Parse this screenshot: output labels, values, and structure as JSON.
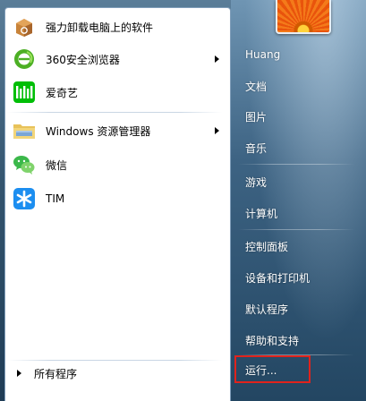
{
  "programs": [
    {
      "label": "强力卸载电脑上的软件",
      "icon": "uninstaller-icon",
      "has_submenu": false
    },
    {
      "label": "360安全浏览器",
      "icon": "360-browser-icon",
      "has_submenu": true
    },
    {
      "label": "爱奇艺",
      "icon": "iqiyi-icon",
      "has_submenu": false
    },
    {
      "label": "Windows 资源管理器",
      "icon": "folder-icon",
      "has_submenu": true
    },
    {
      "label": "微信",
      "icon": "wechat-icon",
      "has_submenu": false
    },
    {
      "label": "TIM",
      "icon": "tim-icon",
      "has_submenu": false
    }
  ],
  "all_programs_label": "所有程序",
  "right_items": [
    {
      "label": "Huang"
    },
    {
      "label": "文档"
    },
    {
      "label": "图片"
    },
    {
      "label": "音乐"
    },
    {
      "label": "游戏"
    },
    {
      "label": "计算机"
    },
    {
      "label": "控制面板"
    },
    {
      "label": "设备和打印机"
    },
    {
      "label": "默认程序"
    },
    {
      "label": "帮助和支持"
    },
    {
      "label": "运行..."
    }
  ],
  "colors": {
    "highlight_border": "#e0231c",
    "iqiyi_green": "#00be06",
    "browser_green": "#4caf24",
    "tim_blue": "#1c8ef0",
    "wechat_green": "#3bb84a"
  }
}
